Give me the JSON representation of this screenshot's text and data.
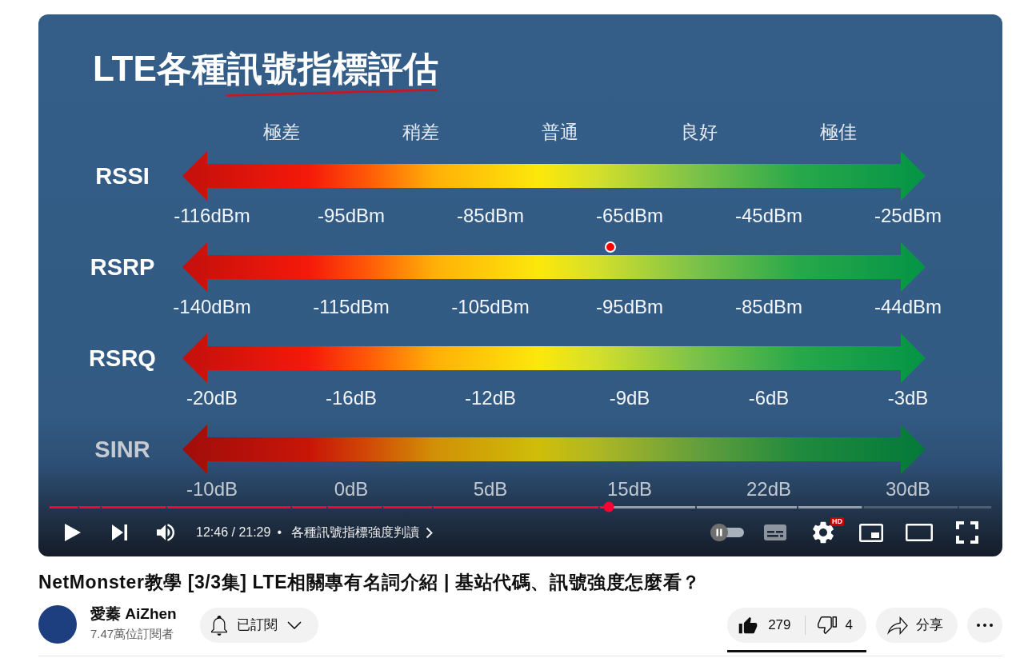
{
  "slide": {
    "title": "LTE各種訊號指標評估",
    "grades": [
      "極差",
      "稍差",
      "普通",
      "良好",
      "極佳"
    ],
    "metrics": [
      {
        "name": "RSSI",
        "values": [
          "-116dBm",
          "-95dBm",
          "-85dBm",
          "-65dBm",
          "-45dBm",
          "-25dBm"
        ]
      },
      {
        "name": "RSRP",
        "values": [
          "-140dBm",
          "-115dBm",
          "-105dBm",
          "-95dBm",
          "-85dBm",
          "-44dBm"
        ]
      },
      {
        "name": "RSRQ",
        "values": [
          "-20dB",
          "-16dB",
          "-12dB",
          "-9dB",
          "-6dB",
          "-3dB"
        ]
      },
      {
        "name": "SINR",
        "values": [
          "-10dB",
          "0dB",
          "5dB",
          "15dB",
          "22dB",
          "30dB"
        ]
      }
    ]
  },
  "player": {
    "progress": {
      "level": 0.594
    },
    "buffer": {
      "level": 0.862
    },
    "playing": false,
    "muted": false,
    "time": "12:46 / 21:29",
    "chapter": {
      "bullet": "•",
      "title": "各種訊號指標強度判讀"
    },
    "autoplay": {
      "on": false
    },
    "captions": {
      "disabled": true
    },
    "quality_badge": "HD"
  },
  "video_title": "NetMonster教學 [3/3集] LTE相關專有名詞介紹 | 基站代碼、訊號強度怎麼看？",
  "channel": {
    "name": "愛蓁 AiZhen",
    "subscribers": "7.47萬位訂閱者",
    "subscribe_button": {
      "label": "已訂閱"
    }
  },
  "actions": {
    "likes": {
      "count": "279",
      "selected": true
    },
    "dislikes": {
      "count": "4",
      "selected": false
    },
    "share": {
      "label": "分享"
    }
  }
}
